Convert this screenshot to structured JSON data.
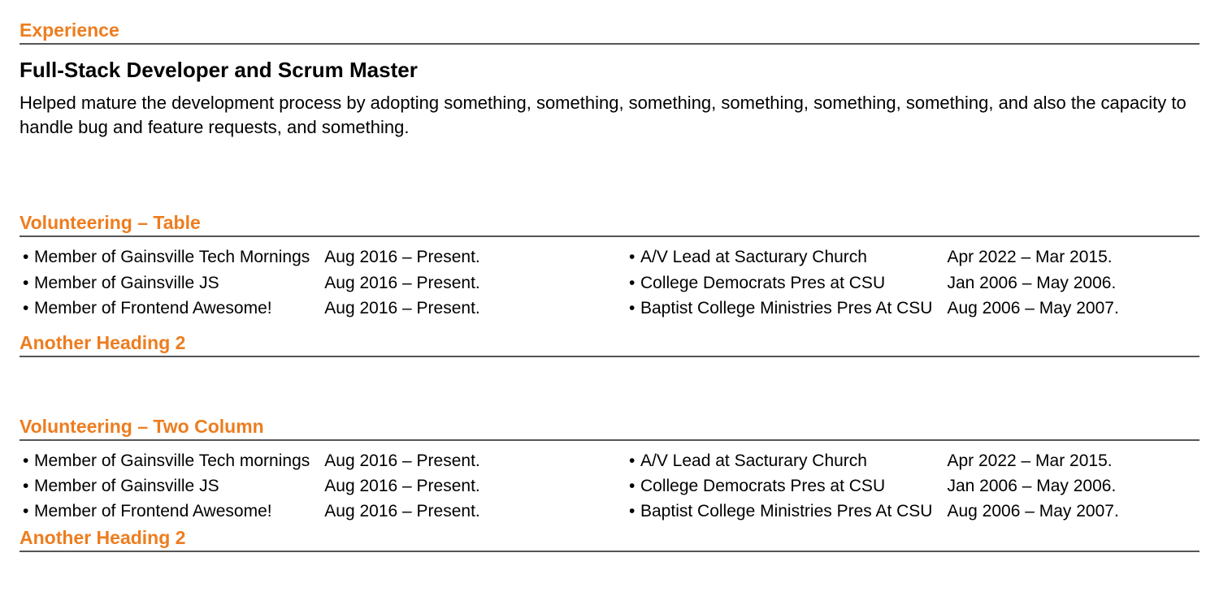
{
  "experience": {
    "heading": "Experience",
    "job_title": "Full-Stack Developer and Scrum Master",
    "job_body": "Helped mature the development process by adopting something, something, something, something, something, something, and also the capacity to handle bug and feature requests, and something."
  },
  "vol_table": {
    "heading": "Volunteering – Table",
    "left": [
      {
        "label": "Member of Gainsville Tech Mornings",
        "date": "Aug 2016 – Present."
      },
      {
        "label": "Member of Gainsville JS",
        "date": "Aug 2016 – Present."
      },
      {
        "label": "Member of Frontend Awesome!",
        "date": "Aug 2016 – Present."
      }
    ],
    "right": [
      {
        "label": "A/V Lead at Sacturary Church",
        "date": "Apr 2022 – Mar 2015."
      },
      {
        "label": "College Democrats Pres at CSU",
        "date": "Jan 2006 – May 2006."
      },
      {
        "label": "Baptist College Ministries Pres At CSU",
        "date": "Aug 2006 – May 2007."
      }
    ],
    "heading_after": "Another Heading 2"
  },
  "vol_twocol": {
    "heading": "Volunteering – Two Column",
    "left": [
      {
        "label": "Member of Gainsville Tech mornings",
        "date": "Aug 2016 – Present."
      },
      {
        "label": "Member of Gainsville JS",
        "date": "Aug 2016 – Present."
      },
      {
        "label": "Member of Frontend Awesome!",
        "date": "Aug 2016 – Present."
      }
    ],
    "right": [
      {
        "label": "A/V Lead at Sacturary Church",
        "date": "Apr 2022 – Mar 2015."
      },
      {
        "label": "College Democrats Pres at CSU",
        "date": "Jan 2006 – May 2006."
      },
      {
        "label": "Baptist College Ministries Pres At CSU",
        "date": "Aug 2006 – May 2007."
      }
    ],
    "heading_after": "Another Heading 2"
  },
  "bullet_glyph": "•"
}
